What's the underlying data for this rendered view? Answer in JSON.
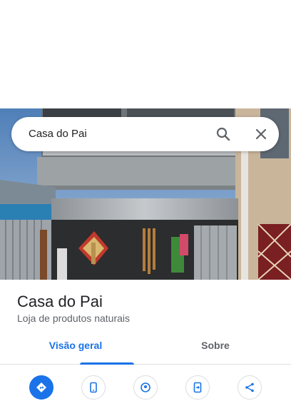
{
  "search": {
    "query": "Casa do Pai",
    "search_icon": "search-icon",
    "close_icon": "close-icon"
  },
  "place": {
    "name": "Casa do Pai",
    "category": "Loja de produtos naturais"
  },
  "tabs": [
    {
      "label": "Visão geral",
      "selected": true
    },
    {
      "label": "Sobre",
      "selected": false
    }
  ],
  "actions": [
    {
      "icon": "directions-icon",
      "style": "primary"
    },
    {
      "icon": "phone-icon",
      "style": "outlined"
    },
    {
      "icon": "nearby-icon",
      "style": "outlined"
    },
    {
      "icon": "send-to-phone-icon",
      "style": "outlined"
    },
    {
      "icon": "share-icon",
      "style": "outlined"
    }
  ],
  "colors": {
    "accent": "#1a73e8",
    "text_primary": "#202124",
    "text_secondary": "#5f6368"
  }
}
